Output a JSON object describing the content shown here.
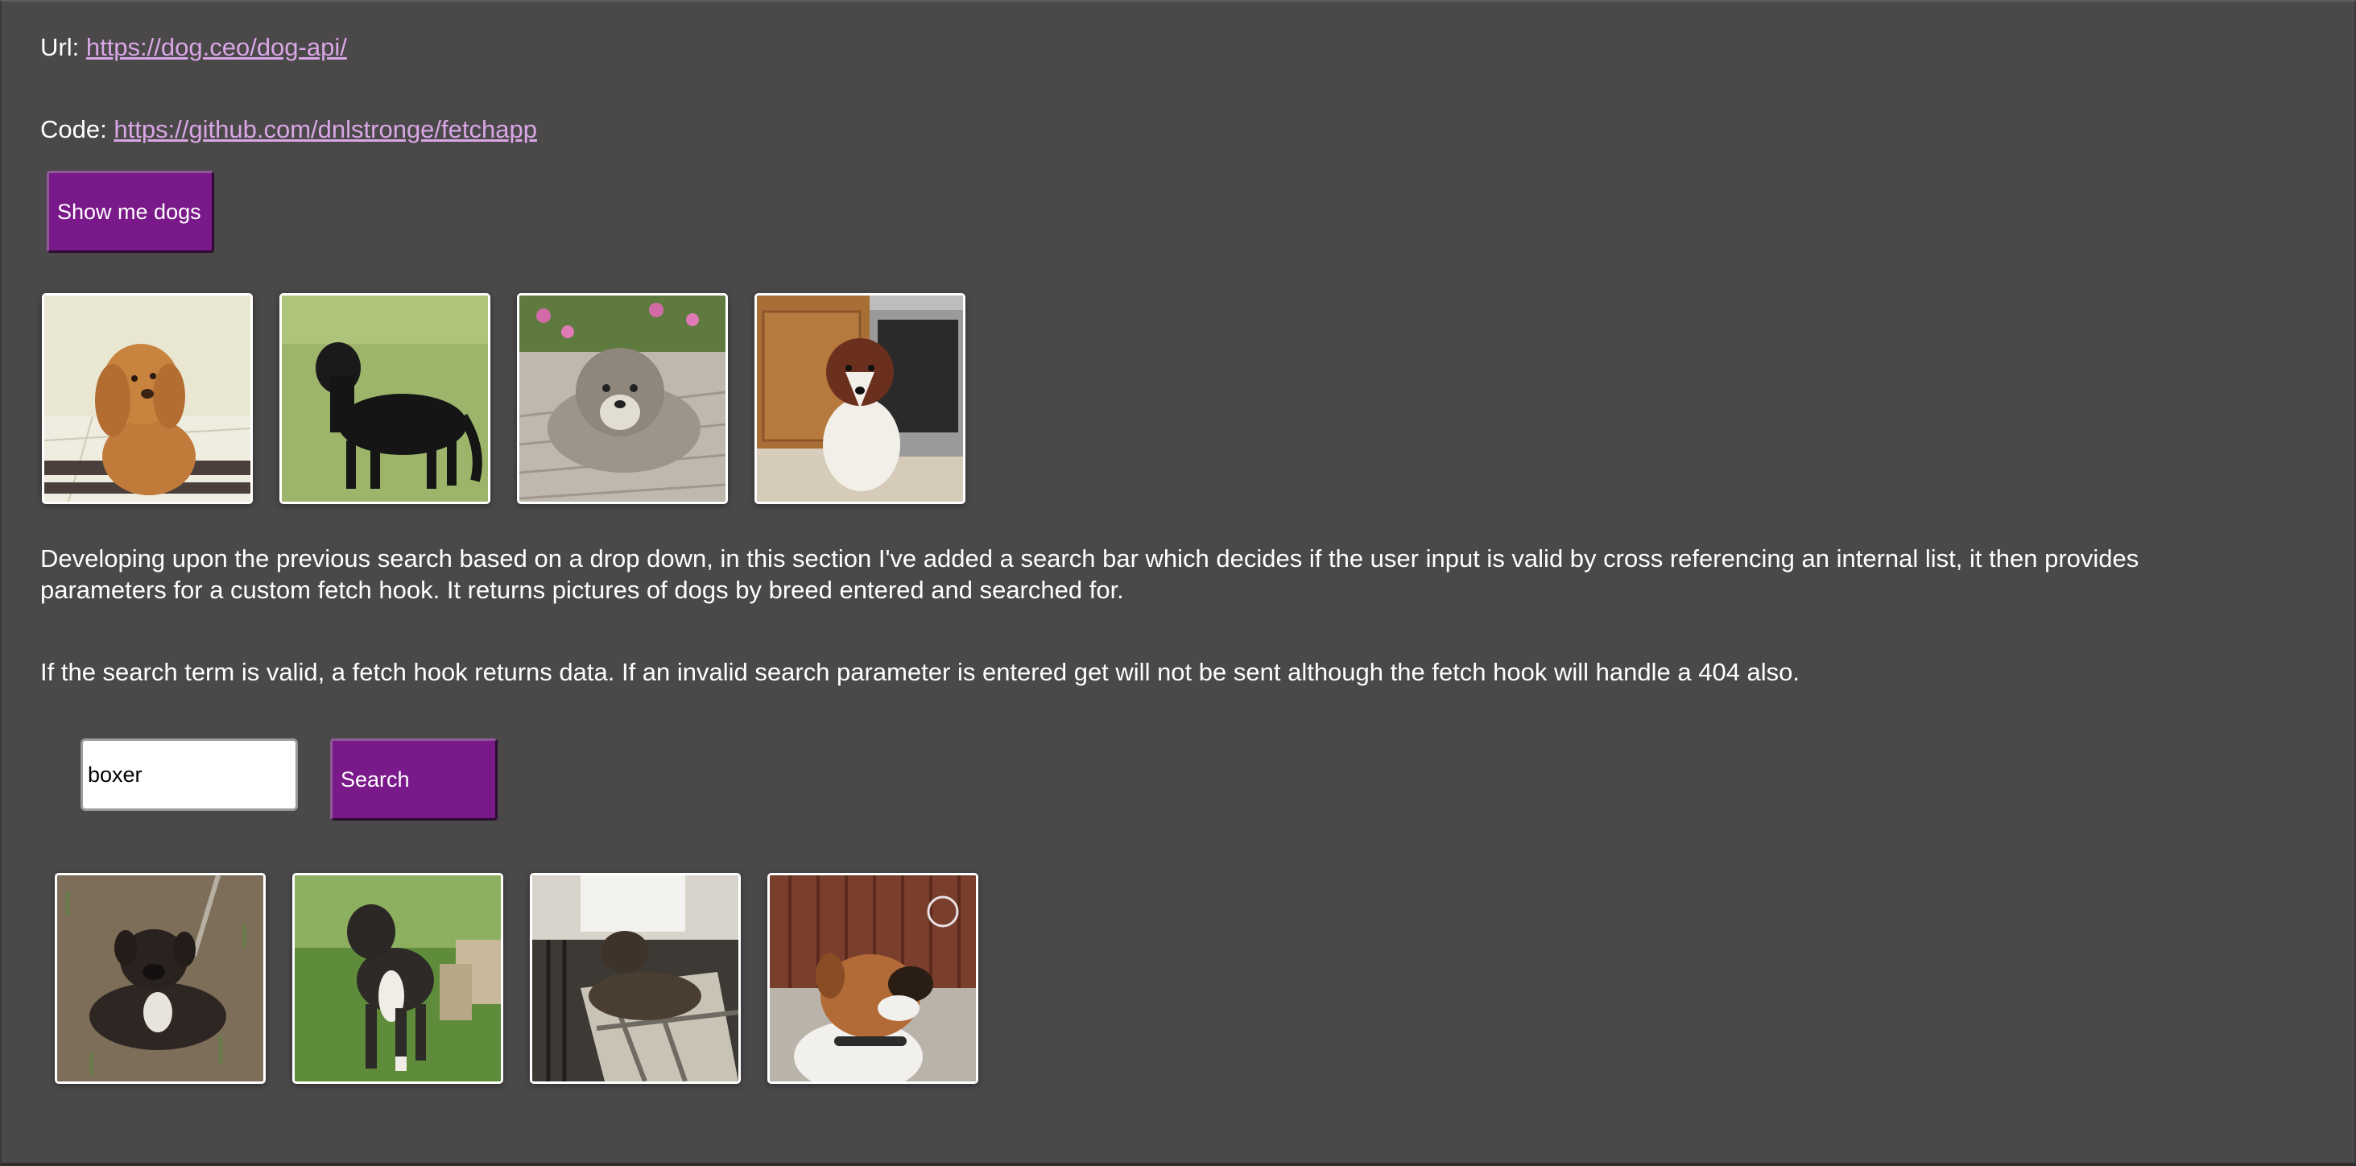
{
  "links": {
    "url_label": "Url:",
    "url_text": "https://dog.ceo/dog-api/",
    "code_label": "Code:",
    "code_text": "https://github.com/dnlstronge/fetchapp"
  },
  "show_button": {
    "label": "Show me dogs"
  },
  "gallery_random": {
    "images": [
      {
        "label": "cocker-spaniel-photo"
      },
      {
        "label": "flat-coated-retriever-photo"
      },
      {
        "label": "shih-tzu-photo"
      },
      {
        "label": "border-collie-photo"
      }
    ]
  },
  "description": {
    "paragraph_1": "Developing upon the previous search based on a drop down, in this section I've added a search bar which decides if the user input is valid by cross referencing an internal list, it then provides parameters for a custom fetch hook. It returns pictures of dogs by breed entered and searched for.",
    "paragraph_2": "If the search term is valid, a fetch hook returns data. If an invalid search parameter is entered get will not be sent although the fetch hook will handle a 404 also."
  },
  "search": {
    "value": "boxer",
    "button_label": "Search"
  },
  "gallery_search": {
    "images": [
      {
        "label": "boxer-puppy-lying-photo"
      },
      {
        "label": "boxer-puppy-standing-photo"
      },
      {
        "label": "boxer-lying-sunlight-photo"
      },
      {
        "label": "boxer-looking-up-photo"
      }
    ]
  }
}
